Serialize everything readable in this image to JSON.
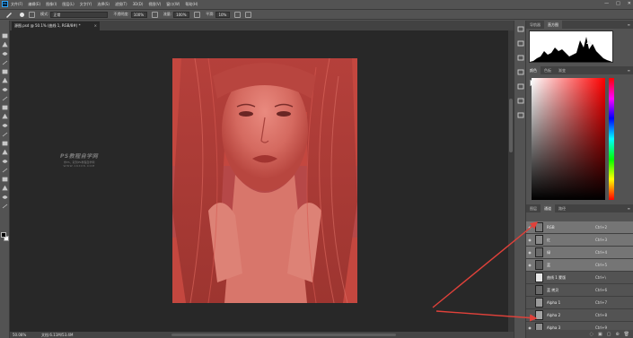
{
  "menu": {
    "items": [
      "文件(F)",
      "编辑(E)",
      "图像(I)",
      "图层(L)",
      "文字(Y)",
      "选择(S)",
      "滤镜(T)",
      "3D(D)",
      "视图(V)",
      "窗口(W)",
      "帮助(H)"
    ],
    "window_controls": [
      "—",
      "□",
      "✕"
    ]
  },
  "options": {
    "mode_label": "模式:",
    "mode_value": "正常",
    "opacity_label": "不透明度:",
    "opacity_value": "100%",
    "flow_label": "流量:",
    "flow_value": "100%",
    "smooth_label": "平滑:",
    "smooth_value": "10%"
  },
  "document": {
    "tab_title": "源图.psd @ 50.1% (曲线 1, RGB/8#) *",
    "tab_close": "×"
  },
  "watermark": {
    "title": "PS教程自学网",
    "subtitle": "学PS，就到PS教程自学网",
    "url": "WWW.16XX8.COM"
  },
  "status": {
    "zoom": "50.08%",
    "doc_info": "文档:6.11M/53.4M"
  },
  "histogram_panel": {
    "tabs": [
      "导航器",
      "直方图"
    ],
    "active_tab": 1,
    "warning_icon": "warning-icon",
    "menu": "≡"
  },
  "color_panel": {
    "tabs": [
      "颜色",
      "色板",
      "渐变"
    ],
    "active_tab": 0,
    "menu": "≡"
  },
  "channels_panel": {
    "tabs": [
      "图层",
      "通道",
      "路径"
    ],
    "active_tab": 1,
    "menu": "≡",
    "rows": [
      {
        "name": "RGB",
        "shortcut": "Ctrl+2",
        "selected": true,
        "visible": true,
        "thumb": "#7a7a7a"
      },
      {
        "name": "红",
        "shortcut": "Ctrl+3",
        "selected": true,
        "visible": true,
        "thumb": "#8a8a8a"
      },
      {
        "name": "绿",
        "shortcut": "Ctrl+4",
        "selected": true,
        "visible": true,
        "thumb": "#6a6a6a"
      },
      {
        "name": "蓝",
        "shortcut": "Ctrl+5",
        "selected": true,
        "visible": true,
        "thumb": "#5c5c5c"
      },
      {
        "name": "曲线 1 蒙版",
        "shortcut": "Ctrl+\\",
        "selected": false,
        "visible": false,
        "thumb": "#e8e8e8"
      },
      {
        "name": "蓝 拷贝",
        "shortcut": "Ctrl+6",
        "selected": false,
        "visible": false,
        "thumb": "#6a6a6a"
      },
      {
        "name": "Alpha 1",
        "shortcut": "Ctrl+7",
        "selected": false,
        "visible": false,
        "thumb": "#9a9a9a"
      },
      {
        "name": "Alpha 2",
        "shortcut": "Ctrl+8",
        "selected": false,
        "visible": false,
        "thumb": "#a4a4a4"
      },
      {
        "name": "Alpha 3",
        "shortcut": "Ctrl+9",
        "selected": false,
        "visible": true,
        "thumb": "#8e8e8e"
      }
    ],
    "bottom_icons": [
      "◌",
      "▣",
      "▢",
      "⊕",
      "🗑"
    ]
  },
  "colors": {
    "accent": "#31a8ff",
    "annotation": "#e0413a",
    "photo_tint": "#c7463f"
  }
}
